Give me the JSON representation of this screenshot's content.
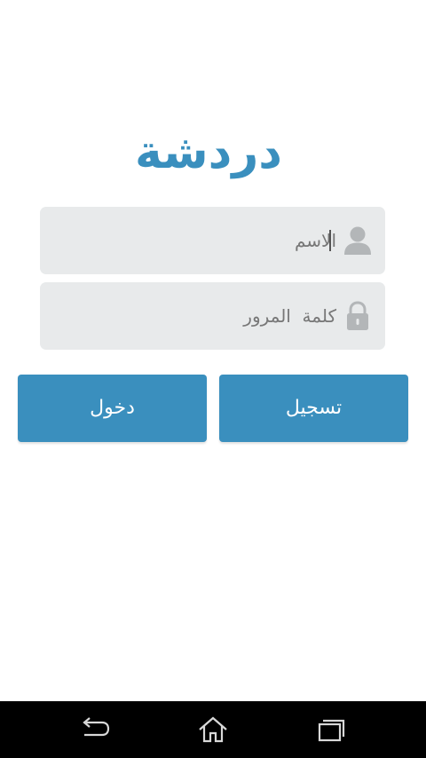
{
  "app": {
    "title": "دردشة"
  },
  "form": {
    "username": {
      "placeholder": "الاسم",
      "value": "",
      "icon": "user-icon"
    },
    "password": {
      "placeholder": "كلمة  المرور",
      "value": "",
      "icon": "lock-icon"
    }
  },
  "buttons": {
    "register_label": "تسجيل",
    "login_label": "دخول"
  },
  "navbar": {
    "back_icon": "back-icon",
    "home_icon": "home-icon",
    "recent_icon": "recent-apps-icon"
  },
  "colors": {
    "accent": "#3a8fbe",
    "field_bg": "#e8eaeb",
    "placeholder": "#777777",
    "navbar_bg": "#000000"
  }
}
